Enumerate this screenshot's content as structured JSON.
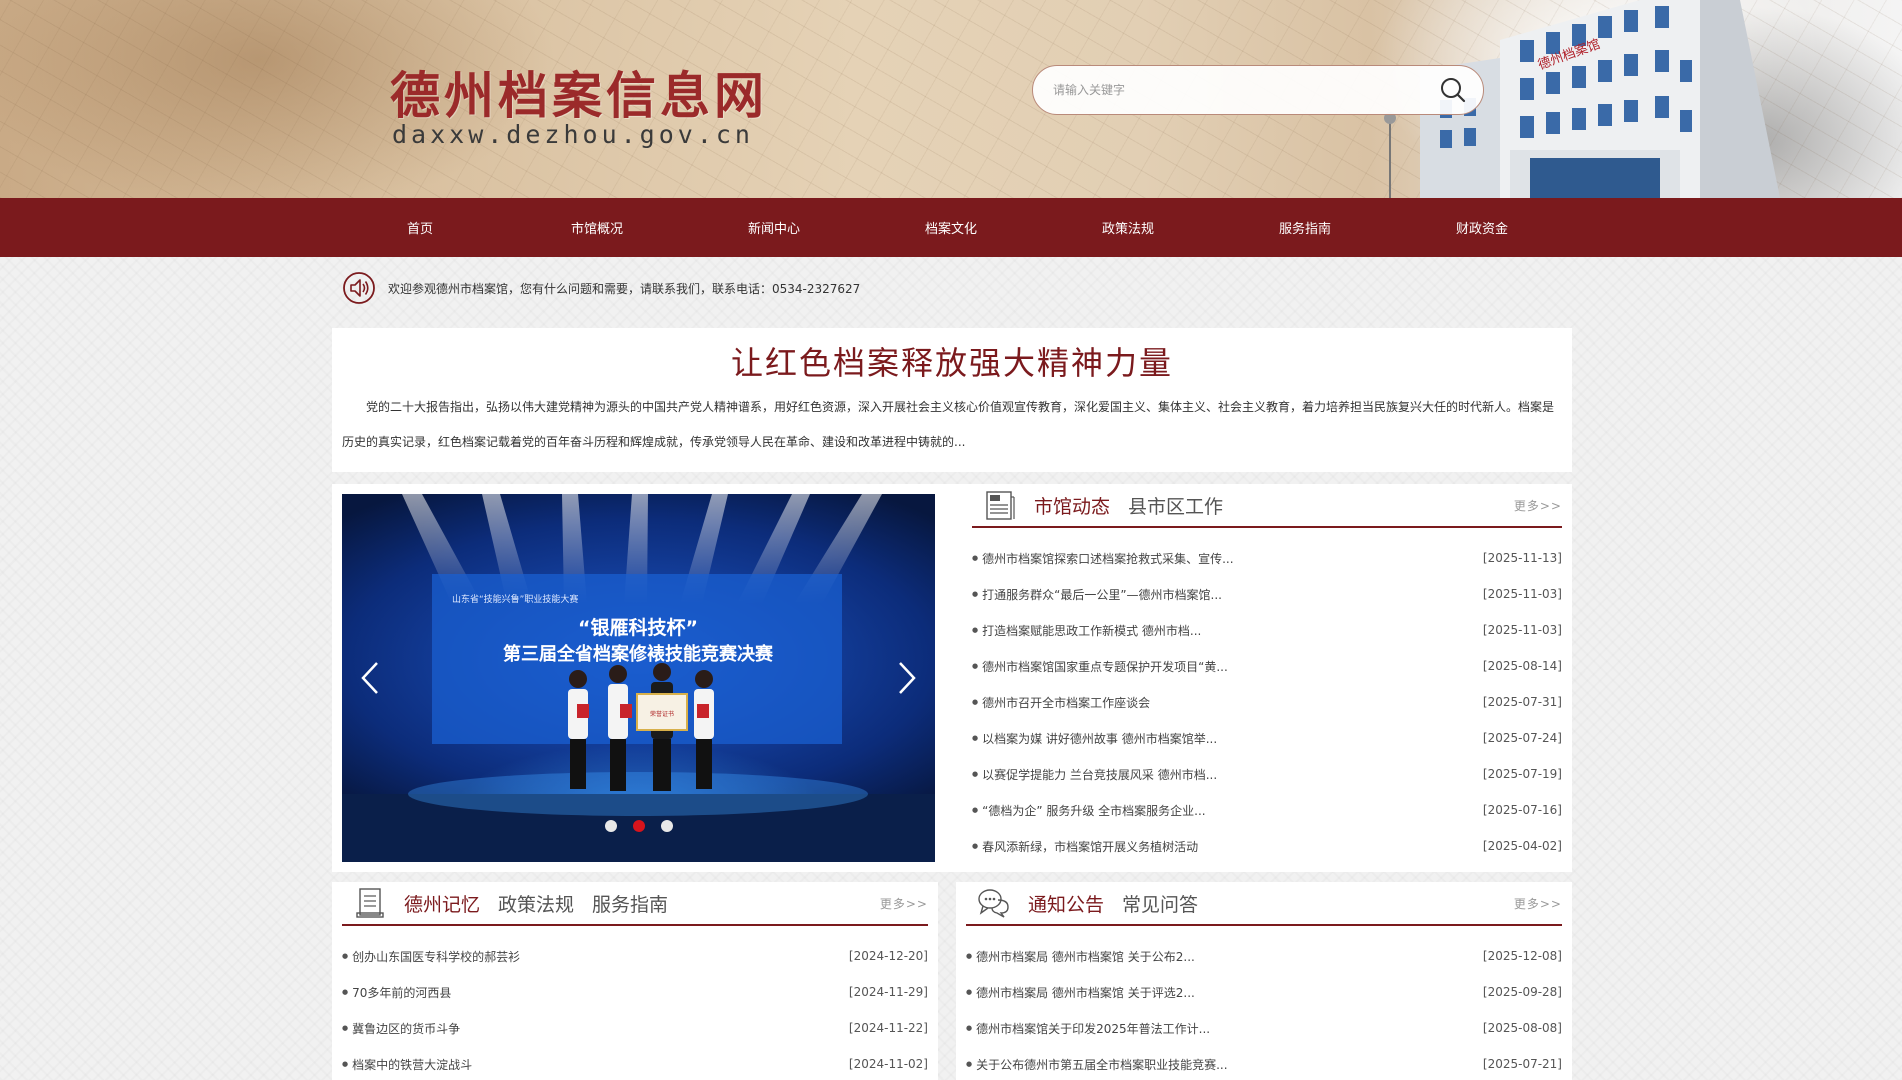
{
  "header": {
    "site_title": "德州档案信息网",
    "site_url": "daxxw.dezhou.gov.cn",
    "building_sign": "德州档案馆",
    "search_placeholder": "请输入关键字"
  },
  "nav": {
    "items": [
      {
        "label": "首页"
      },
      {
        "label": "市馆概况"
      },
      {
        "label": "新闻中心"
      },
      {
        "label": "档案文化"
      },
      {
        "label": "政策法规"
      },
      {
        "label": "服务指南"
      },
      {
        "label": "财政资金"
      }
    ]
  },
  "notice": {
    "text": "欢迎参观德州市档案馆，您有什么问题和需要，请联系我们，联系电话：0534-2327627"
  },
  "headline": {
    "title": "让红色档案释放强大精神力量",
    "summary": "党的二十大报告指出，弘扬以伟大建党精神为源头的中国共产党人精神谱系，用好红色资源，深入开展社会主义核心价值观宣传教育，深化爱国主义、集体主义、社会主义教育，着力培养担当民族复兴大任的时代新人。档案是历史的真实记录，红色档案记载着党的百年奋斗历程和辉煌成就，传承党领导人民在革命、建设和改革进程中铸就的..."
  },
  "carousel": {
    "slide_banner_small": "山东省“技能兴鲁”职业技能大赛",
    "slide_banner_line1": "“银雁科技杯”",
    "slide_banner_line2": "第三届全省档案修裱技能竞赛决赛",
    "slide_plaque": "荣誉证书",
    "active_dot": 1,
    "dot_count": 3
  },
  "city_news": {
    "tab1": "市馆动态",
    "tab2": "县市区工作",
    "more": "更多>>",
    "items": [
      {
        "title": "德州市档案馆探索口述档案抢救式采集、宣传...",
        "date": "[2025-11-13]"
      },
      {
        "title": "打通服务群众“最后一公里”—德州市档案馆...",
        "date": "[2025-11-03]"
      },
      {
        "title": "打造档案赋能思政工作新模式 德州市档...",
        "date": "[2025-11-03]"
      },
      {
        "title": "德州市档案馆国家重点专题保护开发项目“黄...",
        "date": "[2025-08-14]"
      },
      {
        "title": "德州市召开全市档案工作座谈会",
        "date": "[2025-07-31]"
      },
      {
        "title": "以档案为媒 讲好德州故事 德州市档案馆举...",
        "date": "[2025-07-24]"
      },
      {
        "title": "以赛促学提能力 兰台竞技展风采 德州市档...",
        "date": "[2025-07-19]"
      },
      {
        "title": "“德档为企” 服务升级 全市档案服务企业...",
        "date": "[2025-07-16]"
      },
      {
        "title": "春风添新绿，市档案馆开展义务植树活动",
        "date": "[2025-04-02]"
      }
    ]
  },
  "memory": {
    "tab1": "德州记忆",
    "tab2": "政策法规",
    "tab3": "服务指南",
    "more": "更多>>",
    "items": [
      {
        "title": "创办山东国医专科学校的郝芸衫",
        "date": "[2024-12-20]"
      },
      {
        "title": "70多年前的河西县",
        "date": "[2024-11-29]"
      },
      {
        "title": "冀鲁边区的货币斗争",
        "date": "[2024-11-22]"
      },
      {
        "title": "档案中的铁营大淀战斗",
        "date": "[2024-11-02]"
      }
    ]
  },
  "notices": {
    "tab1": "通知公告",
    "tab2": "常见问答",
    "more": "更多>>",
    "items": [
      {
        "title": "德州市档案局 德州市档案馆 关于公布2...",
        "date": "[2025-12-08]"
      },
      {
        "title": "德州市档案局 德州市档案馆 关于评选2...",
        "date": "[2025-09-28]"
      },
      {
        "title": "德州市档案馆关于印发2025年普法工作计...",
        "date": "[2025-08-08]"
      },
      {
        "title": "关于公布德州市第五届全市档案职业技能竞赛...",
        "date": "[2025-07-21]"
      }
    ]
  },
  "colors": {
    "brand": "#7b1a1d",
    "title_red": "#9b2a2a",
    "dot_active": "#d7141c"
  }
}
